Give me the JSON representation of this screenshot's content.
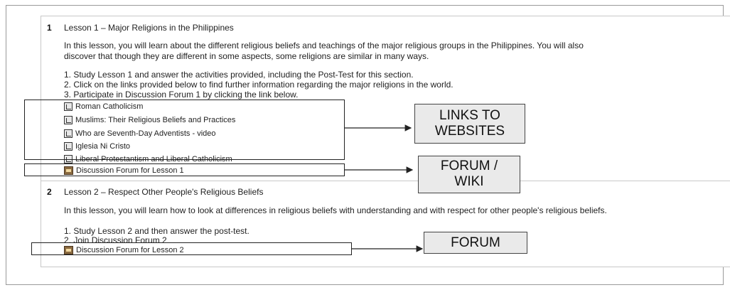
{
  "lesson1": {
    "number": "1",
    "title": "Lesson 1 – Major Religions in the Philippines",
    "intro_line1": "In this lesson, you will learn about the different religious beliefs and teachings of the major religious groups in the Philippines. You will also",
    "intro_line2": "discover that though they are different in some aspects, some religions are similar in many ways.",
    "steps": [
      "1. Study Lesson 1 and answer the activities provided, including the Post-Test for this section.",
      "2. Click on the links provided below to find further information regarding the major religions in the world.",
      "3. Participate in Discussion Forum 1 by clicking the link below."
    ],
    "links": [
      "Roman Catholicism",
      "Muslims: Their Religious Beliefs and Practices",
      "Who are Seventh-Day Adventists - video",
      "Iglesia Ni Cristo",
      "Liberal Protestantism and Liberal Catholicism"
    ],
    "forum": "Discussion Forum for Lesson 1"
  },
  "lesson2": {
    "number": "2",
    "title": "Lesson 2 – Respect Other People's Religious Beliefs",
    "intro": "In this lesson, you will learn how to look at differences in religious beliefs with understanding and with respect for other people's religious beliefs.",
    "steps": [
      "1. Study Lesson 2 and then answer the post-test.",
      "2. Join Discussion Forum 2"
    ],
    "forum": "Discussion Forum for Lesson 2"
  },
  "callouts": {
    "links_line1": "LINKS TO",
    "links_line2": "WEBSITES",
    "forum_wiki_line1": "FORUM /",
    "forum_wiki_line2": "WIKI",
    "forum": "FORUM"
  },
  "icons": {
    "resource": "resource-page-icon",
    "forum": "forum-icon"
  }
}
